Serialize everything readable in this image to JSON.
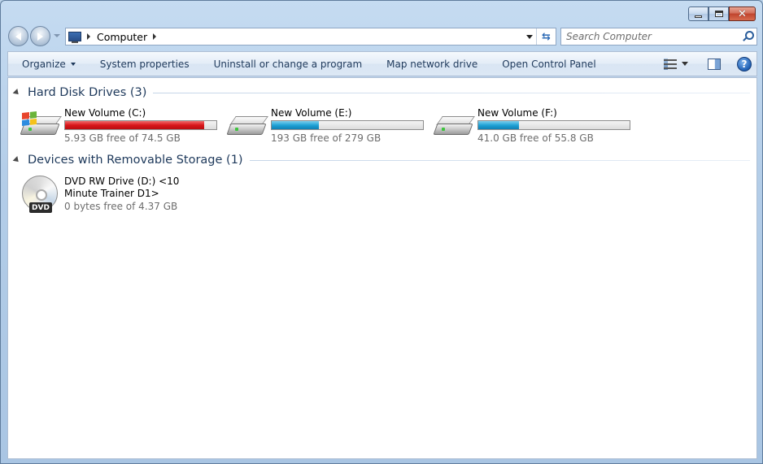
{
  "window": {
    "caption_buttons": {
      "minimize": "minimize",
      "maximize": "maximize",
      "close": "close"
    }
  },
  "nav": {
    "address_crumb": "Computer",
    "search_placeholder": "Search Computer"
  },
  "command_bar": {
    "items": [
      "Organize",
      "System properties",
      "Uninstall or change a program",
      "Map network drive",
      "Open Control Panel"
    ],
    "help_label": "?"
  },
  "groups": {
    "hard_disks": {
      "title": "Hard Disk Drives (3)",
      "drives": [
        {
          "name": "New Volume (C:)",
          "free_text": "5.93 GB free of 74.5 GB",
          "used_fraction": 0.92,
          "bar_color": "#d9161a"
        },
        {
          "name": "New Volume (E:)",
          "free_text": "193 GB free of 279 GB",
          "used_fraction": 0.31,
          "bar_color": "#1fa2d6"
        },
        {
          "name": "New Volume (F:)",
          "free_text": "41.0 GB free of 55.8 GB",
          "used_fraction": 0.27,
          "bar_color": "#1fa2d6"
        }
      ]
    },
    "removable": {
      "title": "Devices with Removable Storage (1)",
      "devices": [
        {
          "name": "DVD RW Drive (D:) <10 Minute Trainer D1>",
          "free_text": "0 bytes free of 4.37 GB",
          "badge": "DVD"
        }
      ]
    }
  },
  "colors": {
    "accent": "#1e395b",
    "bar_low_space": "#d9161a",
    "bar_normal": "#1fa2d6"
  },
  "icons": [
    "back-arrow-icon",
    "forward-arrow-icon",
    "computer-icon",
    "refresh-icon",
    "search-icon",
    "change-view-icon",
    "preview-pane-icon",
    "help-icon",
    "hard-drive-icon",
    "windows-drive-icon",
    "dvd-drive-icon"
  ]
}
